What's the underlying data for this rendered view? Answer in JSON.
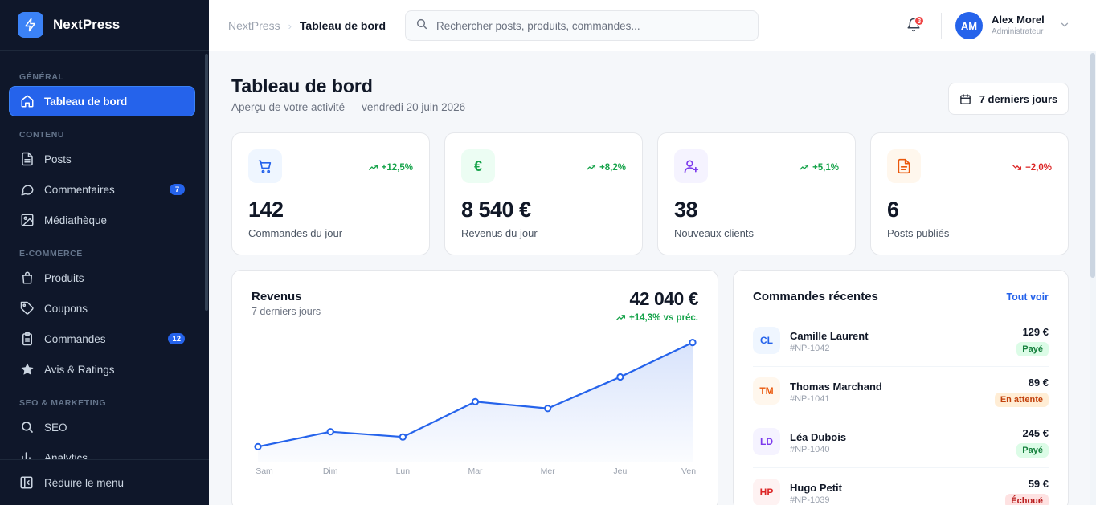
{
  "app": {
    "name": "NextPress"
  },
  "sidebar": {
    "sections": [
      {
        "label": "GÉNÉRAL"
      },
      {
        "label": "CONTENU"
      },
      {
        "label": "E-COMMERCE"
      },
      {
        "label": "SEO & MARKETING"
      }
    ],
    "items": [
      {
        "label": "Tableau de bord",
        "icon": "home-icon",
        "active": true
      },
      {
        "label": "Posts",
        "icon": "document-icon"
      },
      {
        "label": "Commentaires",
        "icon": "comment-icon",
        "badge": "7"
      },
      {
        "label": "Médiathèque",
        "icon": "image-icon"
      },
      {
        "label": "Produits",
        "icon": "shopping-bag-icon"
      },
      {
        "label": "Coupons",
        "icon": "tag-icon"
      },
      {
        "label": "Commandes",
        "icon": "clipboard-icon",
        "badge": "12"
      },
      {
        "label": "Avis & Ratings",
        "icon": "star-icon"
      },
      {
        "label": "SEO",
        "icon": "search-icon"
      },
      {
        "label": "Analytics",
        "icon": "bar-chart-icon"
      }
    ],
    "collapse_label": "Réduire le menu"
  },
  "topbar": {
    "breadcrumb_root": "NextPress",
    "breadcrumb_current": "Tableau de bord",
    "search_placeholder": "Rechercher posts, produits, commandes...",
    "notifications_count": "3",
    "user": {
      "initials": "AM",
      "name": "Alex Morel",
      "role": "Administrateur"
    }
  },
  "page": {
    "title": "Tableau de bord",
    "subtitle": "Aperçu de votre activité — vendredi 20 juin 2026",
    "range_button": "7 derniers jours"
  },
  "stats": [
    {
      "value": "142",
      "label": "Commandes du jour",
      "trend": "+12,5%",
      "trend_dir": "up",
      "icon": "cart-icon",
      "color": "#2563eb",
      "bg": "#eff6ff"
    },
    {
      "value": "8 540 €",
      "label": "Revenus du jour",
      "trend": "+8,2%",
      "trend_dir": "up",
      "icon": "euro-icon",
      "color": "#16a34a",
      "bg": "#ecfdf3"
    },
    {
      "value": "38",
      "label": "Nouveaux clients",
      "trend": "+5,1%",
      "trend_dir": "up",
      "icon": "user-plus-icon",
      "color": "#7c3aed",
      "bg": "#f5f3ff"
    },
    {
      "value": "6",
      "label": "Posts publiés",
      "trend": "−2,0%",
      "trend_dir": "down",
      "icon": "file-text-icon",
      "color": "#ea580c",
      "bg": "#fff7ed"
    }
  ],
  "revenue": {
    "title": "Revenus",
    "subtitle": "7 derniers jours",
    "total": "42 040 €",
    "delta": "+14,3% vs préc."
  },
  "chart_data": {
    "type": "area",
    "categories": [
      "Sam",
      "Dim",
      "Lun",
      "Mar",
      "Mer",
      "Jeu",
      "Ven"
    ],
    "series": [
      {
        "values": [
          2.0,
          4.0,
          3.3,
          8.0,
          7.1,
          11.3,
          15.9
        ]
      }
    ],
    "ylim": [
      0,
      18
    ],
    "grid": false,
    "color": "#2563eb"
  },
  "orders": {
    "title": "Commandes récentes",
    "see_all": "Tout voir",
    "items": [
      {
        "initials": "CL",
        "name": "Camille Laurent",
        "id": "#NP-1042",
        "amount": "129 €",
        "status": "Payé",
        "status_color": "#15803d",
        "status_bg": "#dcfce7",
        "av_color": "#2563eb",
        "av_bg": "#eff6ff"
      },
      {
        "initials": "TM",
        "name": "Thomas Marchand",
        "id": "#NP-1041",
        "amount": "89 €",
        "status": "En attente",
        "status_color": "#c2410c",
        "status_bg": "#ffedd5",
        "av_color": "#ea580c",
        "av_bg": "#fff7ed"
      },
      {
        "initials": "LD",
        "name": "Léa Dubois",
        "id": "#NP-1040",
        "amount": "245 €",
        "status": "Payé",
        "status_color": "#15803d",
        "status_bg": "#dcfce7",
        "av_color": "#7c3aed",
        "av_bg": "#f5f3ff"
      },
      {
        "initials": "HP",
        "name": "Hugo Petit",
        "id": "#NP-1039",
        "amount": "59 €",
        "status": "Échoué",
        "status_color": "#b91c1c",
        "status_bg": "#fee2e2",
        "av_color": "#dc2626",
        "av_bg": "#fef2f2"
      }
    ]
  }
}
